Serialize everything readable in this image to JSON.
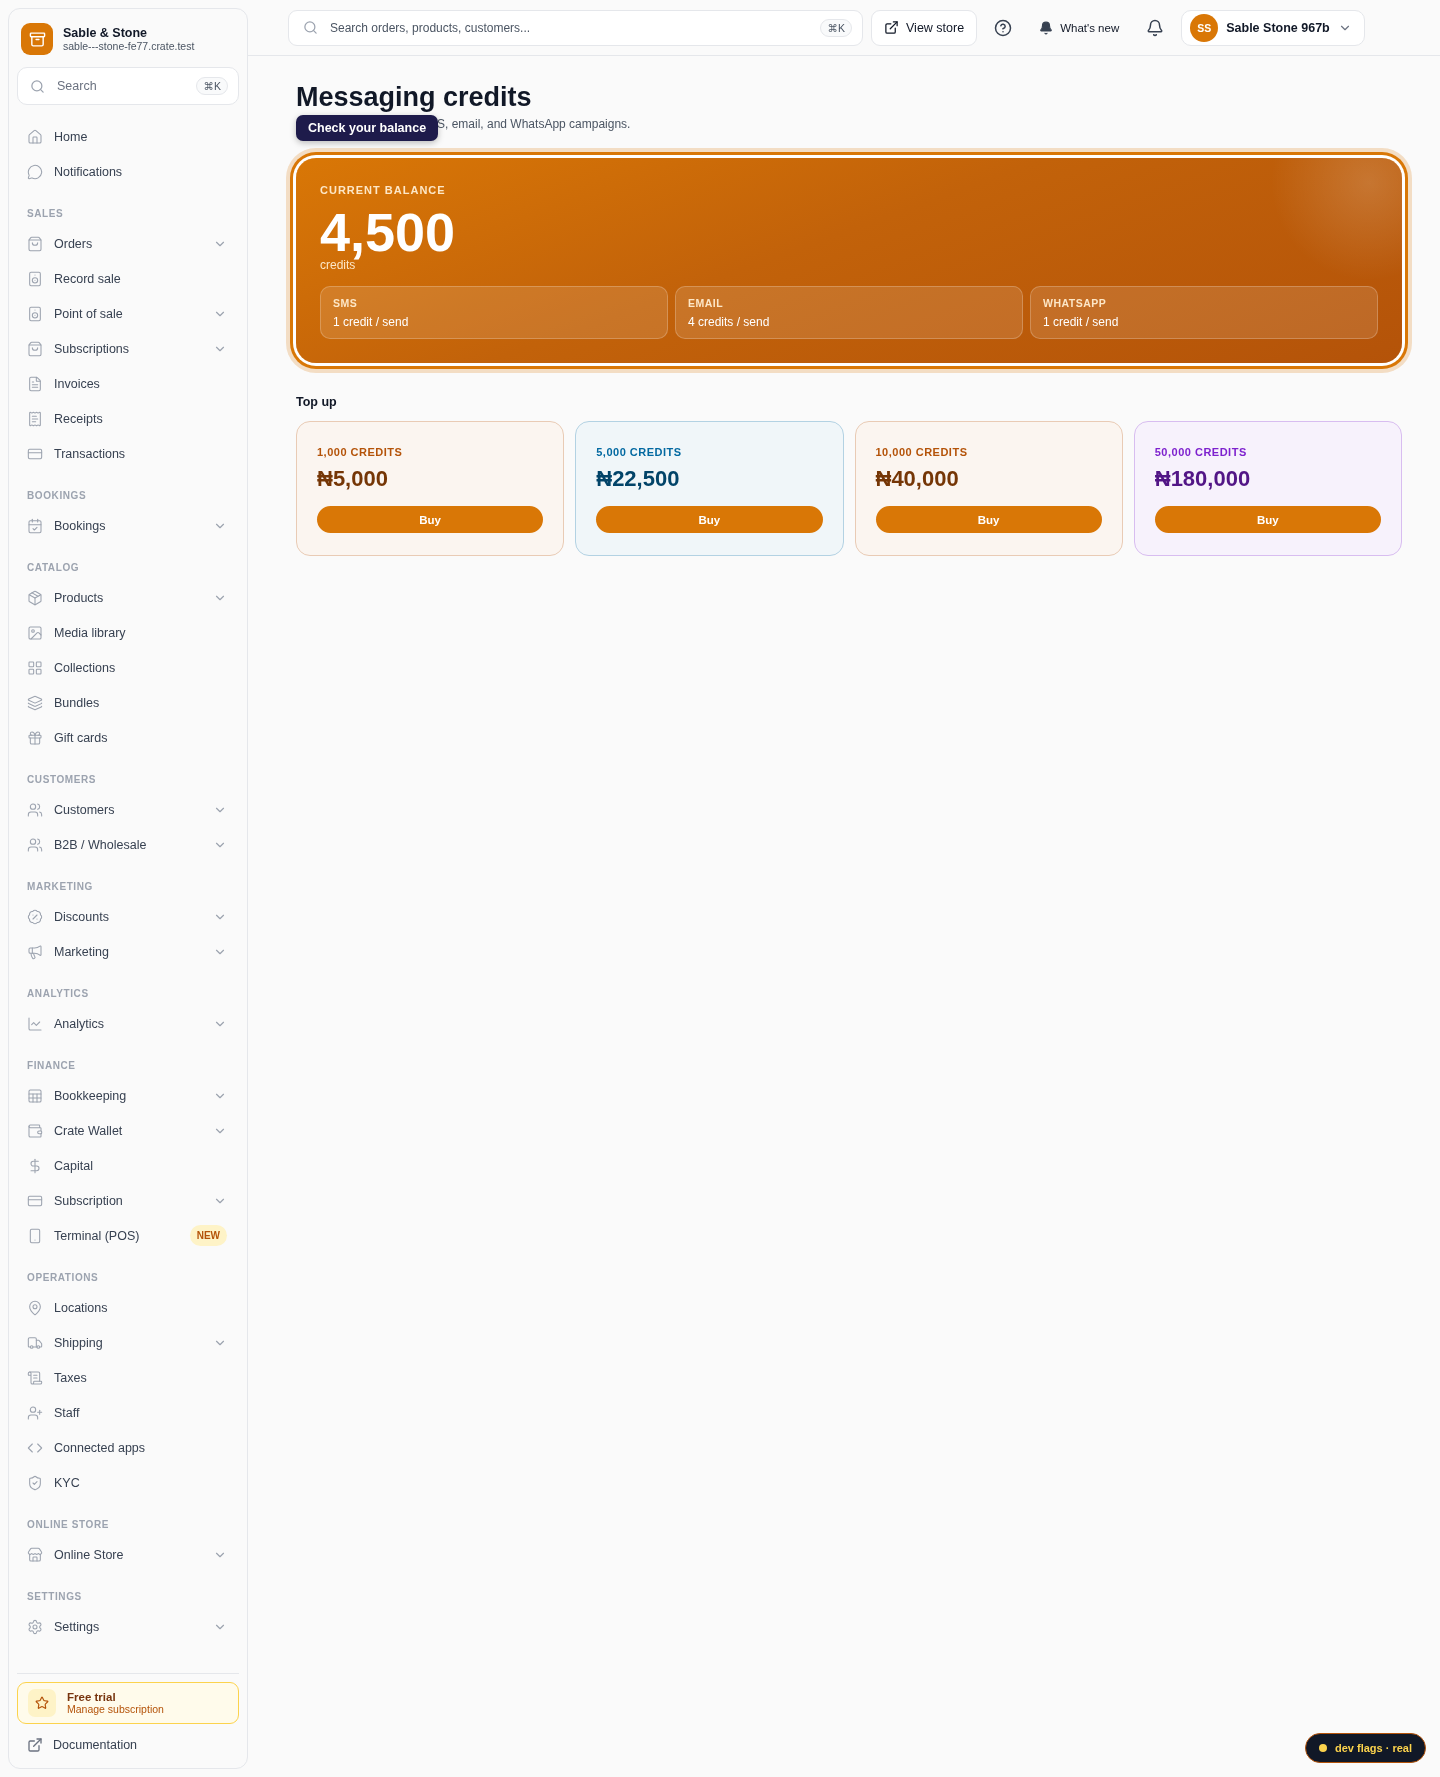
{
  "brand": {
    "name": "Sable & Stone",
    "domain": "sable---stone-fe77.crate.test"
  },
  "sidebar": {
    "search": {
      "placeholder": "Search",
      "shortcut": "⌘K"
    },
    "sections": [
      {
        "items": [
          {
            "label": "Home",
            "has_submenu": false
          },
          {
            "label": "Notifications",
            "has_submenu": false
          }
        ]
      },
      {
        "heading": "SALES",
        "items": [
          {
            "label": "Orders",
            "has_submenu": true
          },
          {
            "label": "Record sale",
            "has_submenu": false
          },
          {
            "label": "Point of sale",
            "has_submenu": true
          },
          {
            "label": "Subscriptions",
            "has_submenu": true
          },
          {
            "label": "Invoices",
            "has_submenu": false
          },
          {
            "label": "Receipts",
            "has_submenu": false
          },
          {
            "label": "Transactions",
            "has_submenu": false
          }
        ]
      },
      {
        "heading": "BOOKINGS",
        "items": [
          {
            "label": "Bookings",
            "has_submenu": true
          }
        ]
      },
      {
        "heading": "CATALOG",
        "items": [
          {
            "label": "Products",
            "has_submenu": true
          },
          {
            "label": "Media library",
            "has_submenu": false
          },
          {
            "label": "Collections",
            "has_submenu": false
          },
          {
            "label": "Bundles",
            "has_submenu": false
          },
          {
            "label": "Gift cards",
            "has_submenu": false
          }
        ]
      },
      {
        "heading": "CUSTOMERS",
        "items": [
          {
            "label": "Customers",
            "has_submenu": true
          },
          {
            "label": "B2B / Wholesale",
            "has_submenu": true
          }
        ]
      },
      {
        "heading": "MARKETING",
        "items": [
          {
            "label": "Discounts",
            "has_submenu": true
          },
          {
            "label": "Marketing",
            "has_submenu": true
          }
        ]
      },
      {
        "heading": "ANALYTICS",
        "items": [
          {
            "label": "Analytics",
            "has_submenu": true
          }
        ]
      },
      {
        "heading": "FINANCE",
        "items": [
          {
            "label": "Bookkeeping",
            "has_submenu": true
          },
          {
            "label": "Crate Wallet",
            "has_submenu": true
          },
          {
            "label": "Capital",
            "has_submenu": false
          },
          {
            "label": "Subscription",
            "has_submenu": true
          },
          {
            "label": "Terminal (POS)",
            "has_submenu": false,
            "badge": "NEW"
          }
        ]
      },
      {
        "heading": "OPERATIONS",
        "items": [
          {
            "label": "Locations",
            "has_submenu": false
          },
          {
            "label": "Shipping",
            "has_submenu": true
          },
          {
            "label": "Taxes",
            "has_submenu": false
          },
          {
            "label": "Staff",
            "has_submenu": false
          },
          {
            "label": "Connected apps",
            "has_submenu": false
          },
          {
            "label": "KYC",
            "has_submenu": false
          }
        ]
      },
      {
        "heading": "ONLINE STORE",
        "items": [
          {
            "label": "Online Store",
            "has_submenu": true
          }
        ]
      },
      {
        "heading": "SETTINGS",
        "items": [
          {
            "label": "Settings",
            "has_submenu": true
          }
        ]
      }
    ],
    "trial": {
      "title": "Free trial",
      "link": "Manage subscription"
    },
    "documentation": "Documentation"
  },
  "topbar": {
    "search": {
      "placeholder": "Search orders, products, customers...",
      "shortcut": "⌘K"
    },
    "view_store": "View store",
    "whats_new": "What's new",
    "account": {
      "initials": "SS",
      "name": "Sable Stone 967b"
    }
  },
  "page": {
    "title": "Messaging credits",
    "subtitle": "S, email, and WhatsApp campaigns.",
    "tooltip": "Check your balance"
  },
  "balance": {
    "label": "CURRENT BALANCE",
    "amount": "4,500",
    "unit": "credits",
    "channels": [
      {
        "name": "SMS",
        "rate": "1 credit / send"
      },
      {
        "name": "EMAIL",
        "rate": "4 credits / send"
      },
      {
        "name": "WHATSAPP",
        "rate": "1 credit / send"
      }
    ]
  },
  "top_up": {
    "heading": "Top up",
    "packs": [
      {
        "credits": "1,000 CREDITS",
        "price": "₦5,000",
        "button": "Buy",
        "color": "#b45309"
      },
      {
        "credits": "5,000 CREDITS",
        "price": "₦22,500",
        "button": "Buy",
        "color": "#0369a1"
      },
      {
        "credits": "10,000 CREDITS",
        "price": "₦40,000",
        "button": "Buy",
        "color": "#b45309"
      },
      {
        "credits": "50,000 CREDITS",
        "price": "₦180,000",
        "button": "Buy",
        "color": "#7e22ce"
      }
    ]
  },
  "dev_flags": "dev flags · real"
}
